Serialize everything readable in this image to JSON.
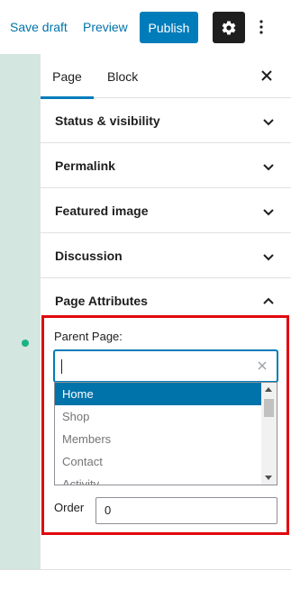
{
  "header": {
    "save_draft": "Save draft",
    "preview": "Preview",
    "publish": "Publish",
    "settings_icon": "gear-icon",
    "more_icon": "vertical-ellipsis-icon"
  },
  "sidebar": {
    "tabs": [
      {
        "label": "Page",
        "active": true
      },
      {
        "label": "Block",
        "active": false
      }
    ],
    "panels": [
      {
        "title": "Status & visibility",
        "expanded": false
      },
      {
        "title": "Permalink",
        "expanded": false
      },
      {
        "title": "Featured image",
        "expanded": false
      },
      {
        "title": "Discussion",
        "expanded": false
      },
      {
        "title": "Page Attributes",
        "expanded": true
      }
    ],
    "page_attributes": {
      "parent_label": "Parent Page:",
      "parent_input_value": "",
      "options": [
        "Home",
        "Shop",
        "Members",
        "Contact",
        "Activity"
      ],
      "selected_option": "Home",
      "order_label": "Order",
      "order_value": "0"
    }
  },
  "colors": {
    "accent": "#007cba",
    "highlight_border": "#e1060d",
    "editor_background": "#d3e6df",
    "status_dot": "#1bb386"
  }
}
